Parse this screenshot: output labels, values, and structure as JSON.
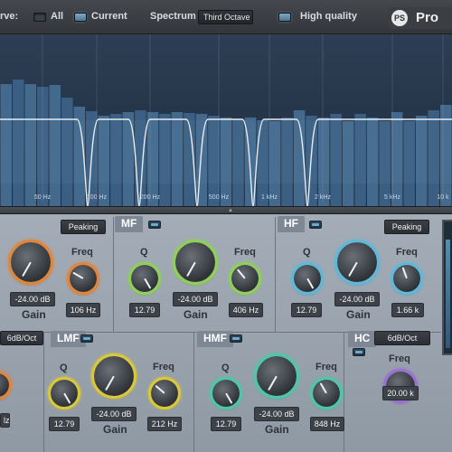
{
  "topbar": {
    "curve_label": "rve:",
    "all_label": "All",
    "current_label": "Current",
    "spectrum_label": "Spectrum",
    "spectrum_value": "Third Octave",
    "hq_label": "High quality",
    "logo_text": "Pro",
    "logo_mark": "PS"
  },
  "display": {
    "freq_labels": [
      "50 Hz",
      "100 Hz",
      "200 Hz",
      "500 Hz",
      "1 kHz",
      "2 kHz",
      "5 kHz",
      "10 k"
    ]
  },
  "bands": {
    "lm_mode": "Peaking",
    "lm_gain": "-24.00 dB",
    "lm_gain_label": "Gain",
    "lm_freq_label": "Freq",
    "lm_freq": "106 Hz",
    "mf_name": "MF",
    "mf_q_label": "Q",
    "mf_q": "12.79",
    "mf_gain": "-24.00 dB",
    "mf_gain_label": "Gain",
    "mf_freq_label": "Freq",
    "mf_freq": "406 Hz",
    "hf_name": "HF",
    "hf_mode": "Peaking",
    "hf_q_label": "Q",
    "hf_q": "12.79",
    "hf_gain": "-24.00 dB",
    "hf_gain_label": "Gain",
    "hf_freq_label": "Freq",
    "hf_freq": "1.66 k",
    "lc_slope": "6dB/Oct",
    "lc_freq": "lz",
    "lmf_name": "LMF",
    "lmf_q_label": "Q",
    "lmf_q": "12.79",
    "lmf_gain": "-24.00 dB",
    "lmf_gain_label": "Gain",
    "lmf_freq_label": "Freq",
    "lmf_freq": "212 Hz",
    "hmf_name": "HMF",
    "hmf_q_label": "Q",
    "hmf_q": "12.79",
    "hmf_gain": "-24.00 dB",
    "hmf_gain_label": "Gain",
    "hmf_freq_label": "Freq",
    "hmf_freq": "848 Hz",
    "hc_name": "HC",
    "hc_slope": "6dB/Oct",
    "hc_freq_label": "Freq",
    "hc_freq": "20.00 k"
  },
  "colors": {
    "lm_ring": "#e0853a",
    "mf_ring": "#8fcf5a",
    "hf_ring": "#5fb8d8",
    "lmf_ring": "#d9c93a",
    "hmf_ring": "#4fc6a8",
    "hc_ring": "#9a6fd0"
  }
}
